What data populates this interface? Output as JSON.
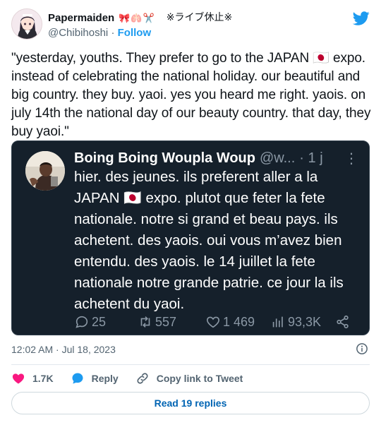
{
  "author": {
    "name": "Papermaiden",
    "emoji": "🎀🫁✂️",
    "suffix": "※ライブ休止※",
    "handle": "@Chibihoshi",
    "separator": "·",
    "follow_label": "Follow"
  },
  "tweet": {
    "text": "\"yesterday, youths. They prefer to go to the JAPAN 🇯🇵 expo. instead of celebrating the national holiday. our beautiful and big country. they buy. yaoi. yes you heard me right. yaois. on july 14th the national day of our beauty country. that day, they buy yaoi.\""
  },
  "quoted": {
    "name": "Boing Boing Woupla Woup",
    "handle": "@w...",
    "time": "· 1 j",
    "more": "⋮",
    "text": "hier. des jeunes. ils preferent aller a la JAPAN 🇯🇵 expo. plutot que feter la fete nationale. notre si grand et beau pays. ils achetent. des yaois. oui vous m’avez bien entendu. des yaois. le 14 juillet la fete nationale notre grande patrie. ce jour la ils achetent du yaoi.",
    "replies": "25",
    "retweets": "557",
    "likes": "1 469",
    "views": "93,3K"
  },
  "timestamp": "12:02 AM · Jul 18, 2023",
  "actions": {
    "likes": "1.7K",
    "reply_label": "Reply",
    "copy_label": "Copy link to Tweet"
  },
  "read_replies_label": "Read 19 replies",
  "colors": {
    "accent": "#1d9bf0",
    "like": "#f91880",
    "dark_card": "#15202b",
    "replies_text": "#0064b3"
  }
}
